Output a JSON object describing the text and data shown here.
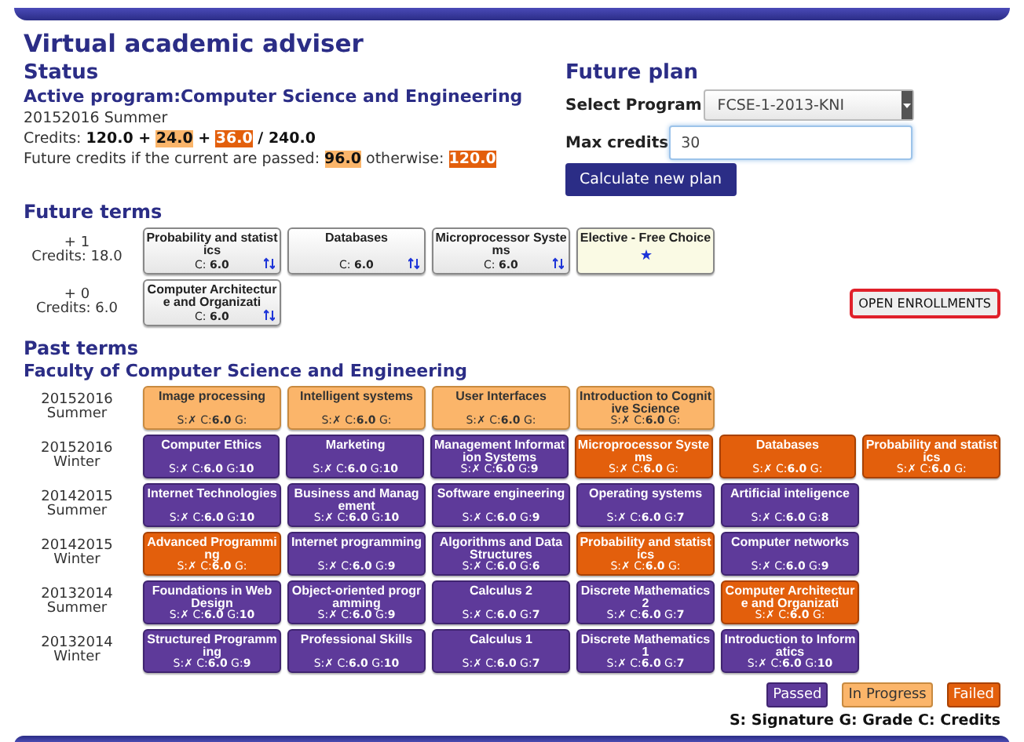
{
  "title": "Virtual academic adviser",
  "status": {
    "heading": "Status",
    "program": "Active program:Computer Science and Engineering",
    "term": "20152016 Summer",
    "credits": [
      {
        "kind": "plain",
        "text": "Credits: "
      },
      {
        "kind": "bold",
        "text": "120.0 + "
      },
      {
        "kind": "progress",
        "text": "24.0"
      },
      {
        "kind": "bold",
        "text": " + "
      },
      {
        "kind": "failed",
        "text": "36.0"
      },
      {
        "kind": "bold",
        "text": " / 240.0"
      }
    ],
    "future_credits": [
      {
        "kind": "plain",
        "text": "Future credits if the current are passed: "
      },
      {
        "kind": "progress",
        "text": "96.0"
      },
      {
        "kind": "plain",
        "text": " otherwise: "
      },
      {
        "kind": "failed",
        "text": "120.0"
      }
    ]
  },
  "future_plan": {
    "heading": "Future plan",
    "program_label": "Select Program",
    "program_value": "FCSE-1-2013-KNI",
    "max_label": "Max credits",
    "max_value": "30",
    "button": "Calculate new plan"
  },
  "future_terms": {
    "heading": "Future terms",
    "button": "OPEN ENROLLMENTS",
    "rows": [
      {
        "step": "+ 1",
        "credits": "Credits: 18.0",
        "courses": [
          {
            "kind": "course",
            "title": "Probability and statistics",
            "credits": "C: **6.0**"
          },
          {
            "kind": "course",
            "title": "Databases",
            "credits": "C: **6.0**"
          },
          {
            "kind": "course",
            "title": "Microprocessor Systems",
            "credits": "C: **6.0**"
          },
          {
            "kind": "elective",
            "title": "Elective - Free Choice"
          }
        ]
      },
      {
        "step": "+ 0",
        "credits": "Credits: 6.0",
        "courses": [
          {
            "kind": "course",
            "title": "Computer Architecture and Organizati",
            "credits": "C: **6.0**"
          }
        ]
      }
    ]
  },
  "past_terms": {
    "heading": "Past terms",
    "faculty": "Faculty of Computer Science and Engineering",
    "rows": [
      {
        "year": "20152016",
        "season": "Summer",
        "courses": [
          {
            "title": "Image processing",
            "kind": "in_progress",
            "stats": "S:✗ C:**6.0** G:"
          },
          {
            "title": "Intelligent systems",
            "kind": "in_progress",
            "stats": "S:✗ C:**6.0** G:"
          },
          {
            "title": "User Interfaces",
            "kind": "in_progress",
            "stats": "S:✗ C:**6.0** G:"
          },
          {
            "title": "Introduction to Cognitive Science",
            "kind": "in_progress",
            "stats": "S:✗ C:**6.0** G:"
          }
        ]
      },
      {
        "year": "20152016",
        "season": "Winter",
        "courses": [
          {
            "title": "Computer Ethics",
            "kind": "passed",
            "stats": "S:✗ C:**6.0** G:**10**"
          },
          {
            "title": "Marketing",
            "kind": "passed",
            "stats": "S:✗ C:**6.0** G:**10**"
          },
          {
            "title": "Management Information Systems",
            "kind": "passed",
            "stats": "S:✗ C:**6.0** G:**9**"
          },
          {
            "title": "Microprocessor Systems",
            "kind": "failed",
            "stats": "S:✗ C:**6.0** G:"
          },
          {
            "title": "Databases",
            "kind": "failed",
            "stats": "S:✗ C:**6.0** G:"
          },
          {
            "title": "Probability and statistics",
            "kind": "failed",
            "stats": "S:✗ C:**6.0** G:"
          }
        ]
      },
      {
        "year": "20142015",
        "season": "Summer",
        "courses": [
          {
            "title": "Internet Technologies",
            "kind": "passed",
            "stats": "S:✗ C:**6.0** G:**10**"
          },
          {
            "title": "Business and Management",
            "kind": "passed",
            "stats": "S:✗ C:**6.0** G:**10**"
          },
          {
            "title": "Software engineering",
            "kind": "passed",
            "stats": "S:✗ C:**6.0** G:**9**"
          },
          {
            "title": "Operating systems",
            "kind": "passed",
            "stats": "S:✗ C:**6.0** G:**7**"
          },
          {
            "title": "Artificial inteligence",
            "kind": "passed",
            "stats": "S:✗ C:**6.0** G:**8**"
          }
        ]
      },
      {
        "year": "20142015",
        "season": "Winter",
        "courses": [
          {
            "title": "Advanced Programming",
            "kind": "failed",
            "stats": "S:✗ C:**6.0** G:"
          },
          {
            "title": "Internet programming",
            "kind": "passed",
            "stats": "S:✗ C:**6.0** G:**9**"
          },
          {
            "title": "Algorithms and Data Structures",
            "kind": "passed",
            "stats": "S:✗ C:**6.0** G:**6**"
          },
          {
            "title": "Probability and statistics",
            "kind": "failed",
            "stats": "S:✗ C:**6.0** G:"
          },
          {
            "title": "Computer networks",
            "kind": "passed",
            "stats": "S:✗ C:**6.0** G:**9**"
          }
        ]
      },
      {
        "year": "20132014",
        "season": "Summer",
        "courses": [
          {
            "title": "Foundations in Web Design",
            "kind": "passed",
            "stats": "S:✗ C:**6.0** G:**10**"
          },
          {
            "title": "Object-oriented programming",
            "kind": "passed",
            "stats": "S:✗ C:**6.0** G:**9**"
          },
          {
            "title": "Calculus 2",
            "kind": "passed",
            "stats": "S:✗ C:**6.0** G:**7**"
          },
          {
            "title": "Discrete Mathematics 2",
            "kind": "passed",
            "stats": "S:✗ C:**6.0** G:**7**"
          },
          {
            "title": "Computer Architecture and Organizati",
            "kind": "failed",
            "stats": "S:✗ C:**6.0** G:"
          }
        ]
      },
      {
        "year": "20132014",
        "season": "Winter",
        "courses": [
          {
            "title": "Structured Programming",
            "kind": "passed",
            "stats": "S:✗ C:**6.0** G:**9**"
          },
          {
            "title": "Professional Skills",
            "kind": "passed",
            "stats": "S:✗ C:**6.0** G:**10**"
          },
          {
            "title": "Calculus 1",
            "kind": "passed",
            "stats": "S:✗ C:**6.0** G:**7**"
          },
          {
            "title": "Discrete Mathematics 1",
            "kind": "passed",
            "stats": "S:✗ C:**6.0** G:**7**"
          },
          {
            "title": "Introduction to Informatics",
            "kind": "passed",
            "stats": "S:✗ C:**6.0** G:**10**"
          }
        ]
      }
    ]
  },
  "legend": {
    "items": [
      {
        "kind": "passed",
        "label": "Passed"
      },
      {
        "kind": "in_progress",
        "label": "In Progress"
      },
      {
        "kind": "failed",
        "label": "Failed"
      }
    ],
    "key": "S: Signature G: Grade C: Credits"
  }
}
